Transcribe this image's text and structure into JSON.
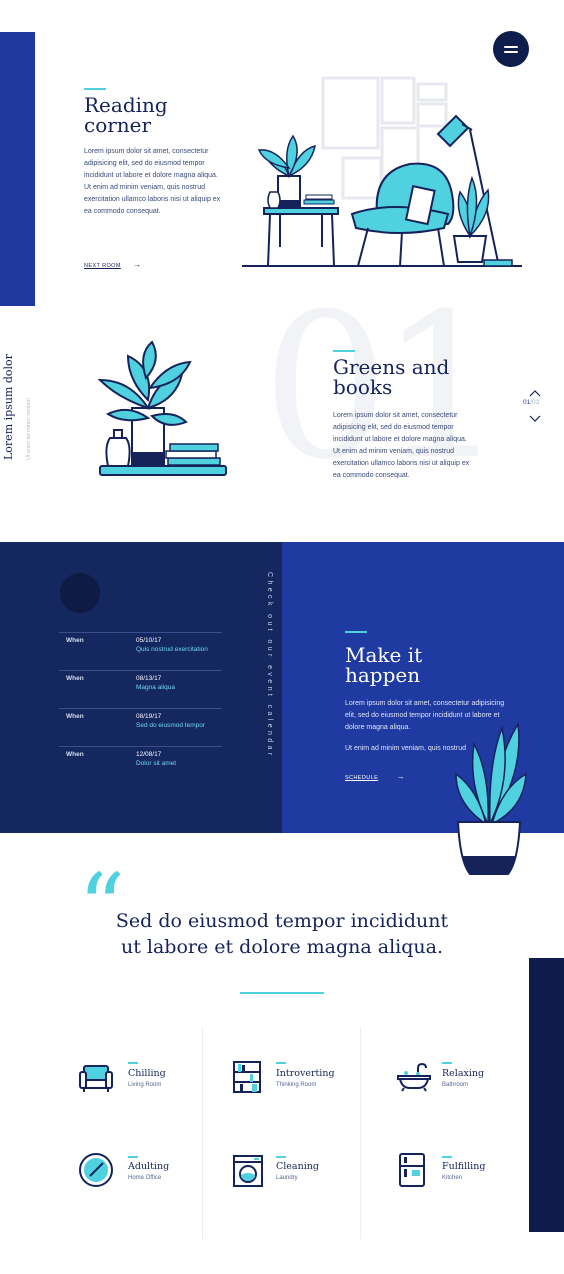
{
  "header": {
    "menu_icon": "menu-icon"
  },
  "reading": {
    "title_line1": "Reading",
    "title_line2": "corner",
    "body": "Lorem ipsum dolor sit amet, consectetur adipisicing elit, sed do eiusmod tempor incididunt ut labore et dolore magna aliqua. Ut enim ad minim veniam, quis nostrud exercitation ullamco laboris nisi ut aliquip ex ea commodo consequat.",
    "link_label": "NEXT ROOM"
  },
  "greens": {
    "side_title": "Lorem ipsum dolor",
    "side_sub": "Ut enim ad minim veniam",
    "big_number": "01",
    "title_line1": "Greens and",
    "title_line2": "books",
    "body": "Lorem ipsum dolor sit amet, consectetur adipisicing elit, sed do eiusmod tempor incididunt ut labore et dolore magna aliqua. Ut enim ad minim veniam, quis nostrud exercitation ullamco laboris nisi ut aliquip ex ea commodo consequat.",
    "pager_current": "01",
    "pager_total": "/03"
  },
  "events": {
    "vertical_label": "Check out our event calendar",
    "rows": [
      {
        "when": "When",
        "date": "05/10/17",
        "desc": "Quis nostrud exercitation"
      },
      {
        "when": "When",
        "date": "08/13/17",
        "desc": "Magna aliqua"
      },
      {
        "when": "When",
        "date": "08/19/17",
        "desc": "Sed do eiusmod tempor"
      },
      {
        "when": "When",
        "date": "12/08/17",
        "desc": "Dolor sit amet"
      }
    ],
    "title_line1": "Make it",
    "title_line2": "happen",
    "body1": "Lorem ipsum dolor sit amet, consectetur adipisicing elit, sed do eiusmod tempor incididunt ut labore et dolore magna aliqua.",
    "body2": "Ut enim ad minim veniam, quis nostrud",
    "link_label": "SCHEDULE"
  },
  "quote": {
    "mark": "“",
    "line1": "Sed do eiusmod tempor incididunt",
    "line2": "ut labore et dolore magna aliqua."
  },
  "categories": [
    {
      "title": "Chilling",
      "sub": "Living Room",
      "icon": "armchair-icon"
    },
    {
      "title": "Introverting",
      "sub": "Thinking Room",
      "icon": "bookshelf-icon"
    },
    {
      "title": "Relaxing",
      "sub": "Bathroom",
      "icon": "bathtub-icon"
    },
    {
      "title": "Adulting",
      "sub": "Home Office",
      "icon": "clock-icon"
    },
    {
      "title": "Cleaning",
      "sub": "Laundry",
      "icon": "washing-machine-icon"
    },
    {
      "title": "Fulfilling",
      "sub": "Kitchen",
      "icon": "fridge-icon"
    }
  ],
  "colors": {
    "navy": "#16235a",
    "royal_blue": "#1f3ba1",
    "dark_navy": "#0f1d4d",
    "cyan": "#4fd1e0"
  }
}
